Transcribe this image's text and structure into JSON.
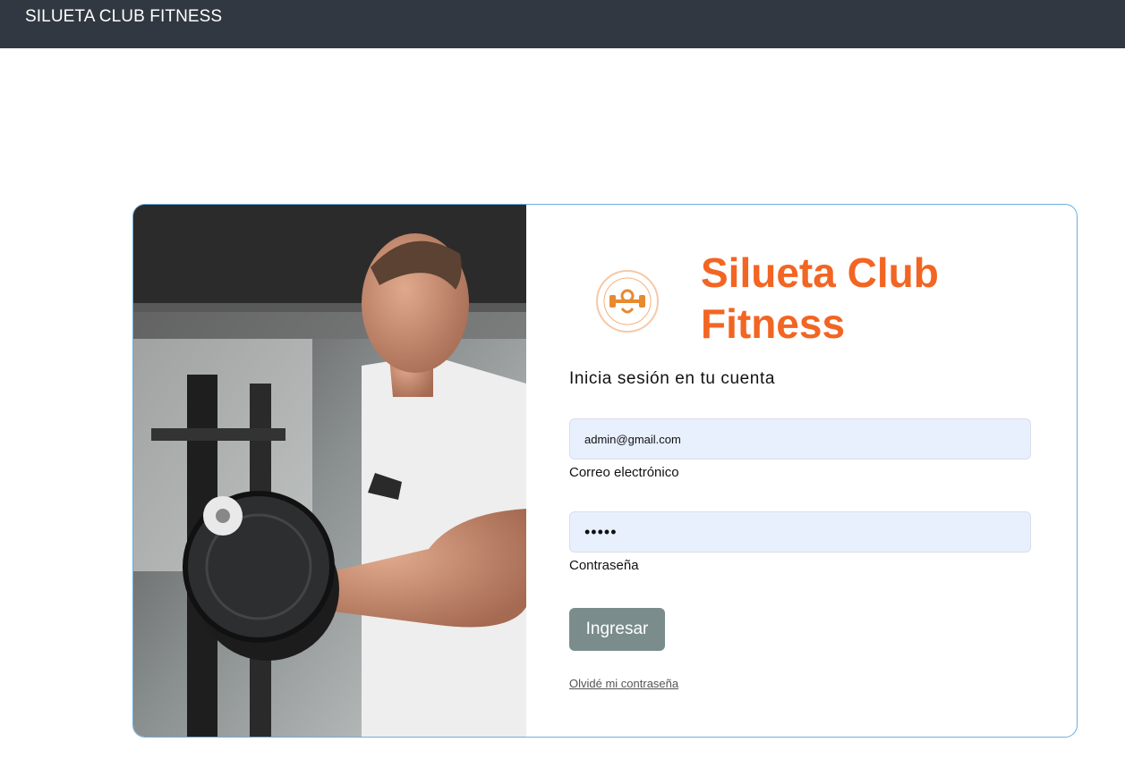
{
  "navbar": {
    "brand": "SILUETA CLUB FITNESS"
  },
  "login": {
    "title": "Silueta Club Fitness",
    "subtitle": "Inicia sesión en tu cuenta",
    "email": {
      "value": "admin@gmail.com",
      "label": "Correo electrónico"
    },
    "password": {
      "value": "•••••",
      "label": "Contraseña"
    },
    "submit_label": "Ingresar",
    "forgot_label": "Olvidé mi contraseña"
  },
  "logo": {
    "text": "SILUETA CLUB FITNESS"
  },
  "colors": {
    "navbar": "#323842",
    "accent": "#f26522",
    "input_bg": "#e8f0fe",
    "button": "#7a8c8c",
    "card_border": "#6aaede"
  }
}
